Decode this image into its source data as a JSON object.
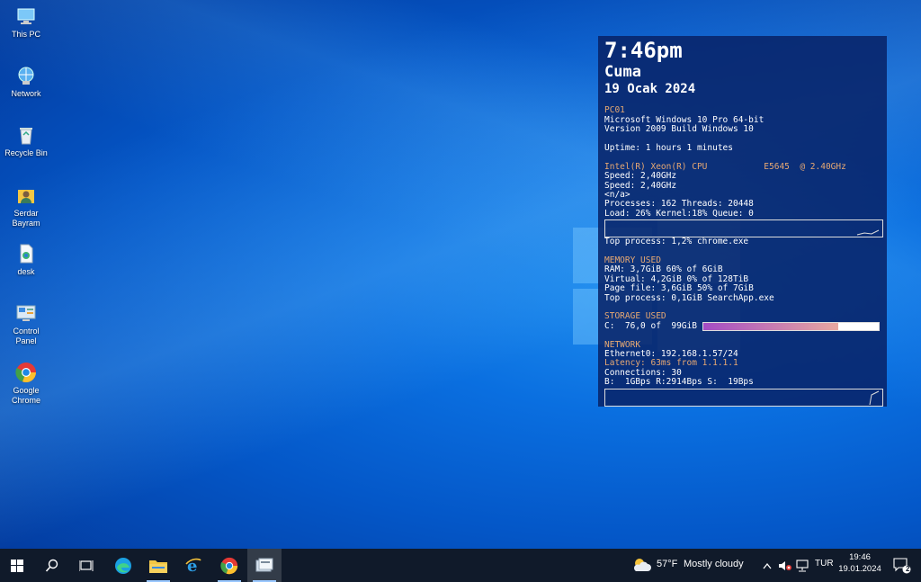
{
  "desktop_icons": [
    {
      "label": "This PC",
      "icon": "this-pc-icon"
    },
    {
      "label": "Network",
      "icon": "network-icon"
    },
    {
      "label": "Recycle Bin",
      "icon": "recycle-bin-icon"
    },
    {
      "label": "Serdar Bayram",
      "icon": "user-folder-icon"
    },
    {
      "label": "desk",
      "icon": "file-icon"
    },
    {
      "label": "Control Panel",
      "icon": "control-panel-icon"
    },
    {
      "label": "Google Chrome",
      "icon": "chrome-icon"
    }
  ],
  "conky": {
    "time": "7:46pm",
    "day": "Cuma",
    "date": "19 Ocak 2024",
    "host": "PC01",
    "os": "Microsoft Windows 10 Pro 64-bit",
    "version": "Version 2009 Build Windows 10",
    "uptime": "Uptime: 1 hours 1 minutes",
    "cpu_name": "Intel(R) Xeon(R) CPU           E5645  @ 2.40GHz",
    "speed1": "Speed: 2,40GHz",
    "speed2": "Speed: 2,40GHz",
    "na": "<n/a>",
    "processes": "Processes: 162 Threads: 20448",
    "load": "Load: 26% Kernel:18% Queue: 0",
    "top_process_cpu": "Top process: 1,2% chrome.exe",
    "memory_head": "MEMORY USED",
    "ram": "RAM: 3,7GiB 60% of 6GiB",
    "virtual": "Virtual: 4,2GiB 0% of 128TiB",
    "pagefile": "Page file: 3,6GiB 50% of 7GiB",
    "top_process_mem": "Top process: 0,1GiB SearchApp.exe",
    "storage_head": "STORAGE USED",
    "storage_c": "C:  76,0 of  99GiB",
    "storage_fraction": 0.77,
    "network_head": "NETWORK",
    "ethernet": "Ethernet0: 192.168.1.57/24",
    "latency": "Latency: 63ms from 1.1.1.1",
    "connections": "Connections: 30",
    "bandwidth": "B:  1GBps R:2914Bps S:  19Bps"
  },
  "taskbar": {
    "apps": [
      "start-icon",
      "search-icon",
      "task-view-icon",
      "edge-icon",
      "file-explorer-icon",
      "internet-explorer-icon",
      "chrome-icon",
      "app-window-icon"
    ],
    "weather_temp": "57°F",
    "weather_text": "Mostly cloudy",
    "language": "TUR",
    "clock_time": "19:46",
    "clock_date": "19.01.2024",
    "notification_count": "2"
  },
  "colors": {
    "conky_header": "#e6a873",
    "taskbar_bg": "#101a2a"
  }
}
